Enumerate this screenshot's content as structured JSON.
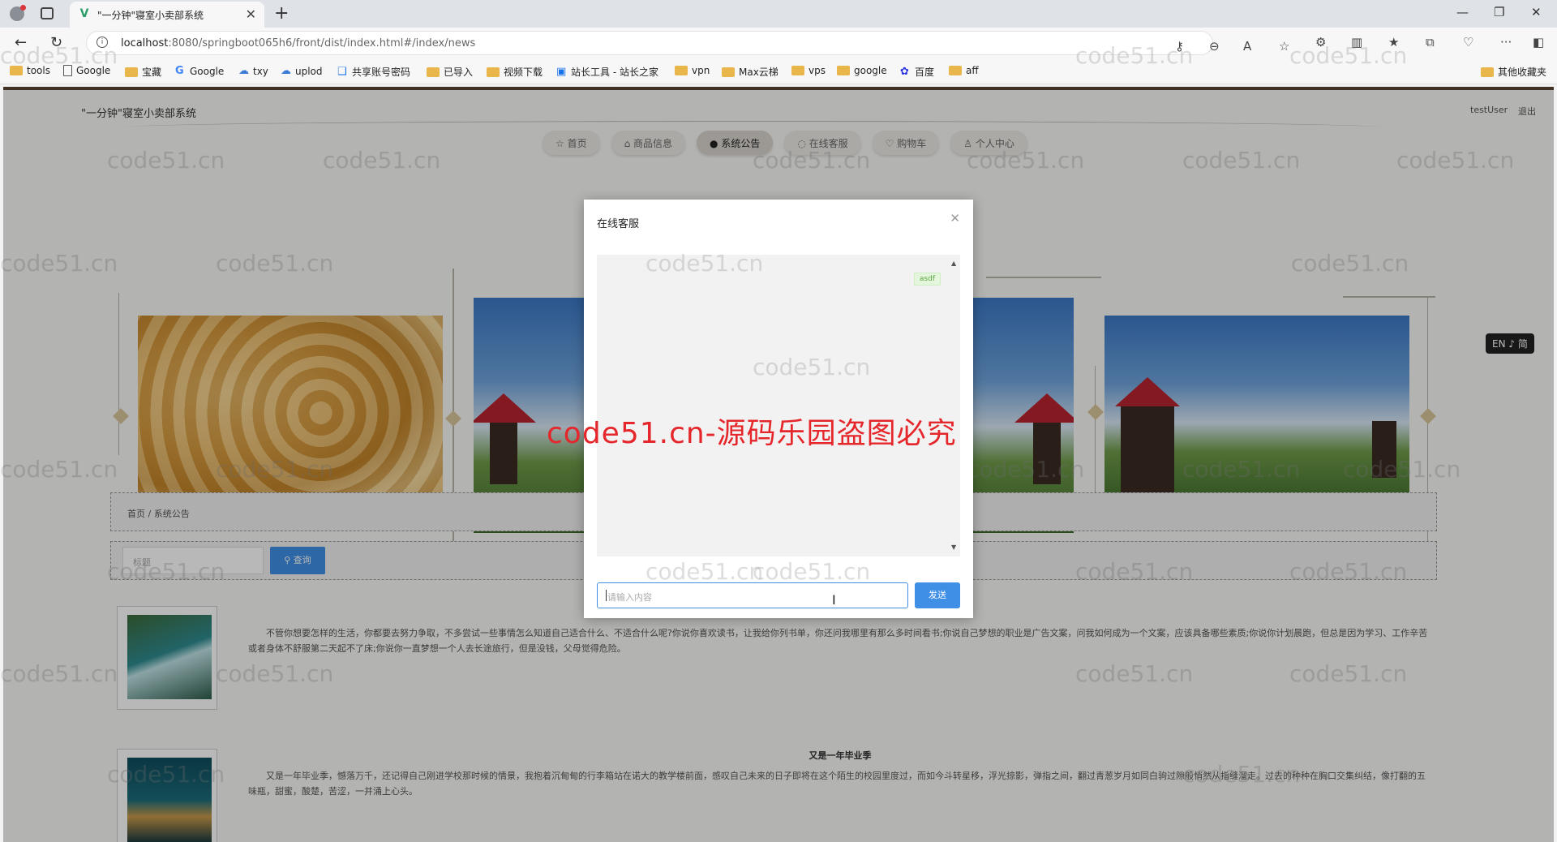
{
  "browser": {
    "tab_title": "\"一分钟\"寝室小卖部系统",
    "url_host": "localhost",
    "url_rest": ":8080/springboot065h6/front/dist/index.html#/index/news",
    "bookmarks": [
      "tools",
      "Google",
      "宝藏",
      "Google",
      "txy",
      "uplod",
      "共享账号密码",
      "已导入",
      "视频下载",
      "站长工具 - 站长之家",
      "vpn",
      "Max云梯",
      "vps",
      "google",
      "百度",
      "aff"
    ],
    "other_bookmarks": "其他收藏夹"
  },
  "site": {
    "title": "\"一分钟\"寝室小卖部系统",
    "user": "testUser",
    "logout": "退出",
    "nav": [
      "首页",
      "商品信息",
      "系统公告",
      "在线客服",
      "购物车",
      "个人中心"
    ],
    "active_nav": "系统公告",
    "breadcrumb_home": "首页",
    "breadcrumb_sep": "/",
    "breadcrumb_current": "系统公告",
    "search_placeholder": "标题",
    "search_button": "查询",
    "lang_badge": "EN ♪ 简"
  },
  "news": [
    {
      "title": "",
      "body": "不管你想要怎样的生活，你都要去努力争取，不多尝试一些事情怎么知道自己适合什么、不适合什么呢?你说你喜欢读书，让我给你列书单，你还问我哪里有那么多时间看书;你说自己梦想的职业是广告文案，问我如何成为一个文案，应该具备哪些素质;你说你计划晨跑，但总是因为学习、工作辛苦或者身体不舒服第二天起不了床;你说你一直梦想一个人去长途旅行，但是没钱，父母觉得危险。"
    },
    {
      "title": "又是一年毕业季",
      "body": "又是一年毕业季，憾落万千，还记得自己刚进学校那时候的情景，我抱着沉甸甸的行李箱站在诺大的教学楼前面，感叹自己未来的日子即将在这个陌生的校园里度过，而如今斗转星移，浮光掠影，弹指之间，翻过青葱岁月如同白驹过隙般悄然从指缝溜走。过去的种种在胸口交集纠结，像打翻的五味瓶，甜蜜，酸楚，苦涩，一并涌上心头。"
    }
  ],
  "modal": {
    "title": "在线客服",
    "message": "asdf",
    "input_placeholder": "请输入内容",
    "send_button": "发送"
  },
  "watermark": "code51.cn",
  "stamp": "code51.cn-源码乐园盗图必究"
}
